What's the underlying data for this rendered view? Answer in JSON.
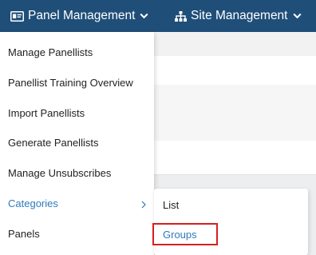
{
  "topnav": {
    "panel_management": {
      "label": "Panel Management",
      "icon": "id-card-icon"
    },
    "site_management": {
      "label": "Site Management",
      "icon": "sitemap-icon"
    }
  },
  "dropdown": {
    "items": [
      {
        "label": "Manage Panellists"
      },
      {
        "label": "Panellist Training Overview"
      },
      {
        "label": "Import Panellists"
      },
      {
        "label": "Generate Panellists"
      },
      {
        "label": "Manage Unsubscribes"
      },
      {
        "label": "Categories",
        "active": true,
        "has_submenu": true
      },
      {
        "label": "Panels"
      }
    ]
  },
  "submenu": {
    "items": [
      {
        "label": "List"
      },
      {
        "label": "Groups",
        "highlighted": true
      }
    ]
  },
  "colors": {
    "topbar": "#1f4e79",
    "active_link": "#2e7bbd",
    "highlight_border": "#d71f1f"
  }
}
